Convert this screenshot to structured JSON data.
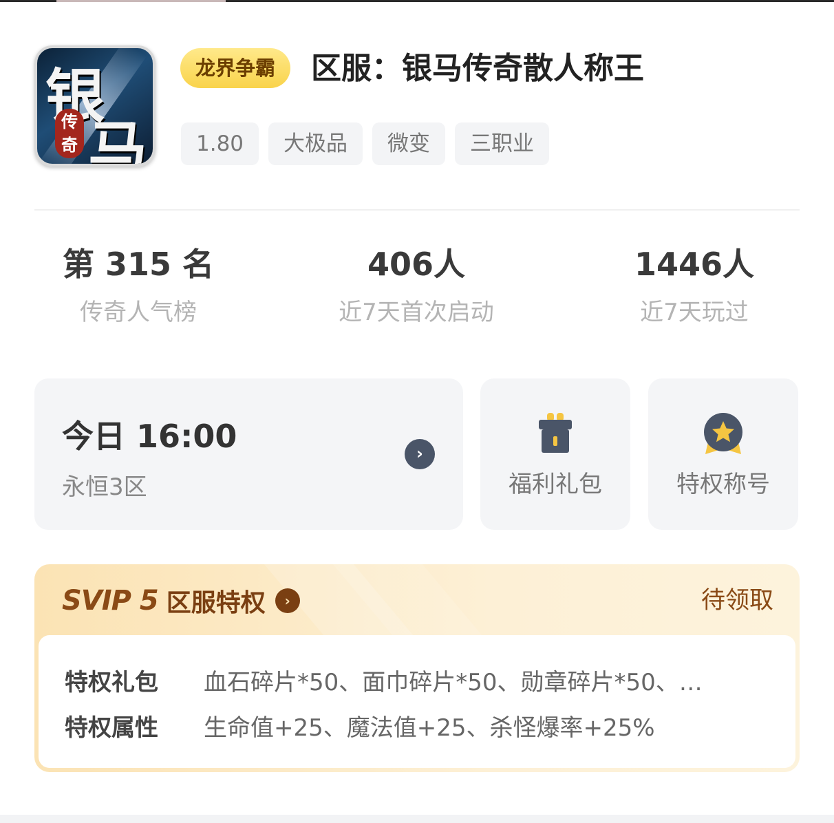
{
  "game": {
    "icon_name": "silver-horse-legend-icon",
    "icon_text_1": "银",
    "icon_text_2": "马",
    "icon_seal": "传奇",
    "tag": "龙界争霸",
    "title": "区服：银马传奇散人称王",
    "chips": [
      "1.80",
      "大极品",
      "微变",
      "三职业"
    ]
  },
  "stats": [
    {
      "value": "第 315 名",
      "label": "传奇人气榜"
    },
    {
      "value": "406人",
      "label": "近7天首次启动"
    },
    {
      "value": "1446人",
      "label": "近7天玩过"
    }
  ],
  "server_card": {
    "time": "今日 16:00",
    "server": "永恒3区",
    "go_icon": "chevron-right-icon"
  },
  "quick_cards": [
    {
      "label": "福利礼包",
      "icon": "gift-box-icon"
    },
    {
      "label": "特权称号",
      "icon": "star-medal-icon"
    }
  ],
  "svip": {
    "level": "SVIP 5",
    "name": "区服特权",
    "status": "待领取",
    "rows": [
      {
        "key": "特权礼包",
        "value": "血石碎片*50、面巾碎片*50、勋章碎片*50、…"
      },
      {
        "key": "特权属性",
        "value": "生命值+25、魔法值+25、杀怪爆率+25%"
      }
    ]
  },
  "colors": {
    "tag_bg": "#f9d34b",
    "svip_bg": "#fbe3b4",
    "svip_text": "#7a3f12",
    "card_bg": "#f4f5f7"
  }
}
